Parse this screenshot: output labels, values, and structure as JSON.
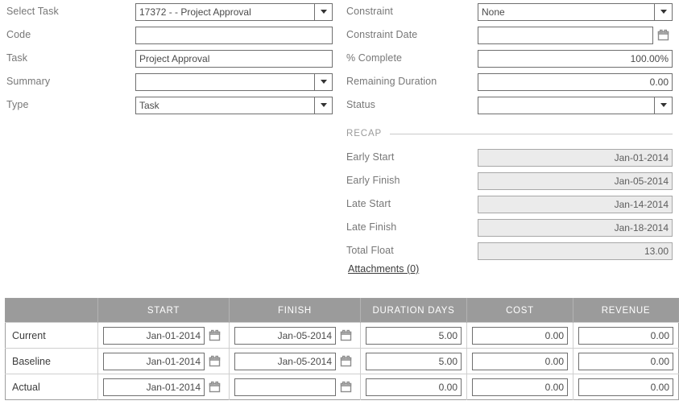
{
  "left_fields": [
    {
      "label": "Select Task",
      "value": "17372 -  - Project Approval",
      "type": "select"
    },
    {
      "label": "Code",
      "value": "",
      "type": "text"
    },
    {
      "label": "Task",
      "value": "Project Approval",
      "type": "text"
    },
    {
      "label": "Summary",
      "value": "",
      "type": "select"
    },
    {
      "label": "Type",
      "value": "Task",
      "type": "select"
    }
  ],
  "right_fields": [
    {
      "label": "Constraint",
      "value": "None",
      "type": "select"
    },
    {
      "label": "Constraint Date",
      "value": "",
      "type": "date"
    },
    {
      "label": "% Complete",
      "value": "100.00%",
      "type": "number"
    },
    {
      "label": "Remaining Duration",
      "value": "0.00",
      "type": "number"
    },
    {
      "label": "Status",
      "value": "",
      "type": "select"
    }
  ],
  "recap": {
    "title": "RECAP",
    "fields": [
      {
        "label": "Early Start",
        "value": "Jan-01-2014"
      },
      {
        "label": "Early Finish",
        "value": "Jan-05-2014"
      },
      {
        "label": "Late Start",
        "value": "Jan-14-2014"
      },
      {
        "label": "Late Finish",
        "value": "Jan-18-2014"
      },
      {
        "label": "Total Float",
        "value": "13.00"
      }
    ],
    "attachments_link": "Attachments (0)"
  },
  "table": {
    "headers": [
      "",
      "START",
      "FINISH",
      "DURATION DAYS",
      "COST",
      "REVENUE"
    ],
    "rows": [
      {
        "label": "Current",
        "start": "Jan-01-2014",
        "finish": "Jan-05-2014",
        "duration": "5.00",
        "cost": "0.00",
        "revenue": "0.00"
      },
      {
        "label": "Baseline",
        "start": "Jan-01-2014",
        "finish": "Jan-05-2014",
        "duration": "5.00",
        "cost": "0.00",
        "revenue": "0.00"
      },
      {
        "label": "Actual",
        "start": "Jan-01-2014",
        "finish": "",
        "duration": "0.00",
        "cost": "0.00",
        "revenue": "0.00"
      }
    ]
  },
  "icons": {
    "dropdown": "chevron-down-icon",
    "calendar": "calendar-icon"
  },
  "colors": {
    "header_bg": "#9b9b9b",
    "label_text": "#777777",
    "readonly_bg": "#ebebeb",
    "border": "#6f6f6f"
  }
}
